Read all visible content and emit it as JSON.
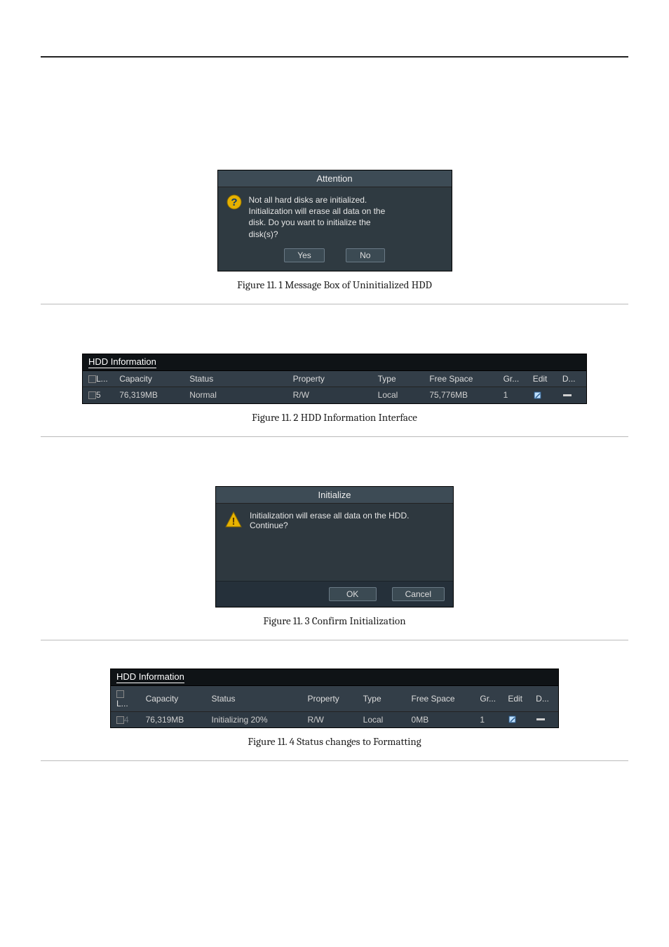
{
  "attention": {
    "title": "Attention",
    "message_line1": "Not all hard disks are initialized.",
    "message_line2": "Initialization will erase all data on the",
    "message_line3": "disk. Do you want to initialize the",
    "message_line4": "disk(s)?",
    "yes": "Yes",
    "no": "No"
  },
  "captions": {
    "c1": "Figure 11. 1  Message Box of Uninitialized HDD",
    "c2": "Figure 11. 2 HDD Information Interface",
    "c3": "Figure 11. 3  Confirm Initialization",
    "c4": "Figure 11. 4 Status changes to Formatting"
  },
  "hdd_section_title": "HDD Information",
  "hdd_headers": {
    "cb": "L...",
    "capacity": "Capacity",
    "status": "Status",
    "property": "Property",
    "type": "Type",
    "free": "Free Space",
    "gr": "Gr...",
    "edit": "Edit",
    "del": "D..."
  },
  "hdd_table1_row": {
    "idx": "5",
    "capacity": "76,319MB",
    "status": "Normal",
    "property": "R/W",
    "type": "Local",
    "free": "75,776MB",
    "gr": "1"
  },
  "init_dialog": {
    "title": "Initialize",
    "line1": "Initialization will erase all data on the HDD.",
    "line2": "Continue?",
    "ok": "OK",
    "cancel": "Cancel"
  },
  "hdd_table2_row": {
    "idx": "4",
    "capacity": "76,319MB",
    "status": "Initializing 20%",
    "property": "R/W",
    "type": "Local",
    "free": "0MB",
    "gr": "1"
  }
}
